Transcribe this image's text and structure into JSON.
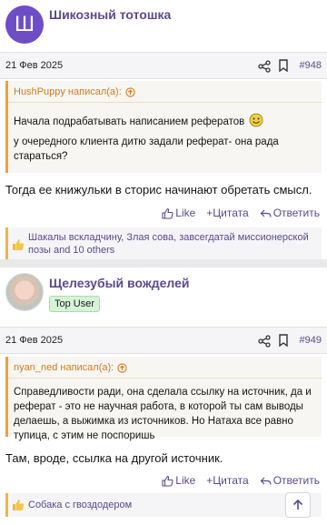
{
  "posts": [
    {
      "username": "Шикозный тотошка",
      "avatar_letter": "Ш",
      "date": "21 Фев 2025",
      "post_number": "#948",
      "quote": {
        "author_line": "HushPuppy написал(а):",
        "lines": [
          "Начала подрабатывать написанием рефератов",
          "у очередного клиента дитю задали реферат- она рада стараться?"
        ]
      },
      "body": "Тогда ее книжульки в сторис начинают обретать смысл.",
      "actions": [
        "Like",
        "+Цитата",
        "Ответить"
      ],
      "reactions": "Шакалы вскладчину, Злая сова, завсегдатай миссионерской позы and 10 others"
    },
    {
      "username": "Щелезубый вожделей",
      "badge": "Top User",
      "date": "21 Фев 2025",
      "post_number": "#949",
      "quote": {
        "author_line": "nyan_ned написал(а):",
        "lines": [
          "Справедливости ради, она сделала ссылку на источник, да и реферат - это не научная работа, в которой ты сам выводы делаешь, а выжимка из источников. Но Натаха все равно тупица, с этим не поспоришь"
        ]
      },
      "body": "Там, вроде, ссылка на другой источник.",
      "actions": [
        "Like",
        "+Цитата",
        "Ответить"
      ],
      "reactions": "Собака с гвоздодером"
    }
  ],
  "icons": {
    "share": "share-icon",
    "bookmark": "bookmark-icon",
    "like": "thumbs-up-icon",
    "scroll_top": "arrow-up-icon"
  },
  "colors": {
    "accent": "#5b4a8a",
    "quote_accent": "#d27c1f",
    "avatar": "#6e4dc6",
    "badge_bg": "#d7f3d7"
  }
}
